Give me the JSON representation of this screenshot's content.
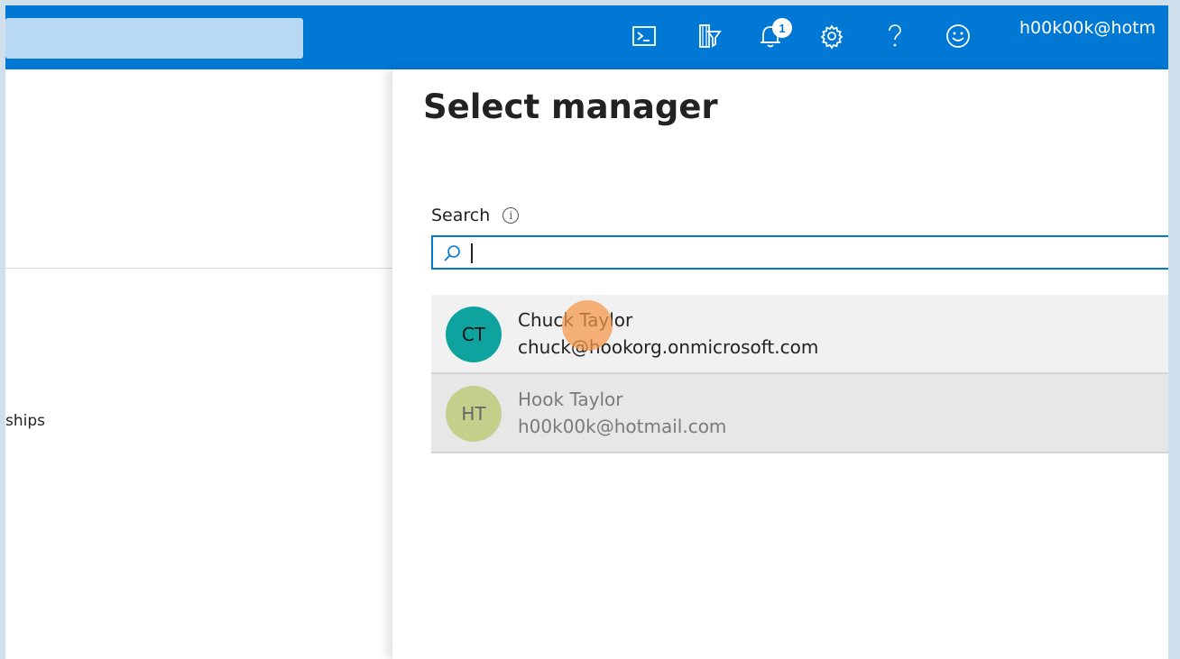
{
  "header": {
    "search_value": "",
    "notification_count": "1",
    "account": "h00k00k@hotm",
    "icons": [
      "cloud-shell-icon",
      "directory-filter-icon",
      "notifications-icon",
      "settings-icon",
      "help-icon",
      "feedback-icon"
    ],
    "accent_color": "#0078d4"
  },
  "left_pane": {
    "partial_item": "ships"
  },
  "blade": {
    "title": "Select manager",
    "search_label": "Search",
    "search_value": "",
    "results": [
      {
        "initials": "CT",
        "name": "Chuck Taylor",
        "email": "chuck@hookorg.onmicrosoft.com",
        "avatar_color": "#0fa3a0"
      },
      {
        "initials": "HT",
        "name": "Hook Taylor",
        "email": "h00k00k@hotmail.com",
        "avatar_color": "#c3cf8a"
      }
    ]
  }
}
